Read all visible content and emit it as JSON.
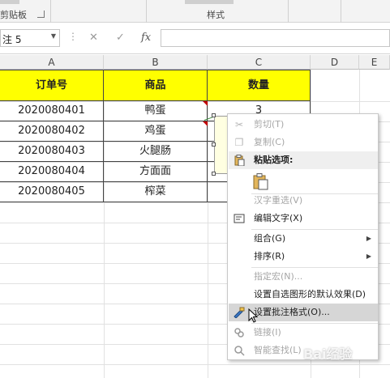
{
  "ribbon": {
    "clipboard_group": "剪贴板",
    "styles_group": "样式"
  },
  "formula_bar": {
    "name_box": "注 5",
    "cancel_icon": "✕",
    "enter_icon": "✓",
    "fx_label": "fx",
    "formula_value": ""
  },
  "columns": [
    "A",
    "B",
    "C",
    "D",
    "E"
  ],
  "table": {
    "headers": [
      "订单号",
      "商品",
      "数量"
    ],
    "rows": [
      {
        "order": "2020080401",
        "product": "鸭蛋",
        "qty": "3"
      },
      {
        "order": "2020080402",
        "product": "鸡蛋",
        "qty": ""
      },
      {
        "order": "2020080403",
        "product": "火腿肠",
        "qty": ""
      },
      {
        "order": "2020080404",
        "product": "方面面",
        "qty": ""
      },
      {
        "order": "2020080405",
        "product": "榨菜",
        "qty": ""
      }
    ]
  },
  "colors": {
    "header_fill": "#ffff00",
    "comment_fill": "#ffffe1",
    "comment_marker": "#c00000"
  },
  "context_menu": {
    "items": [
      {
        "label": "剪切(T)",
        "icon": "scissors-icon",
        "disabled": true
      },
      {
        "label": "复制(C)",
        "icon": "copy-icon",
        "disabled": true
      },
      {
        "label": "粘贴选项:",
        "icon": "paste-icon",
        "disabled": false
      },
      {
        "label": "汉字重选(V)",
        "icon": "",
        "disabled": true
      },
      {
        "label": "编辑文字(X)",
        "icon": "edit-text-icon",
        "disabled": false
      },
      {
        "label": "组合(G)",
        "icon": "",
        "disabled": false,
        "submenu": true
      },
      {
        "label": "排序(R)",
        "icon": "",
        "disabled": false,
        "submenu": true
      },
      {
        "label": "指定宏(N)...",
        "icon": "",
        "disabled": true
      },
      {
        "label": "设置自选图形的默认效果(D)",
        "icon": "",
        "disabled": false
      },
      {
        "label": "设置批注格式(O)...",
        "icon": "format-comment-icon",
        "disabled": false,
        "highlighted": true
      },
      {
        "label": "链接(I)",
        "icon": "link-icon",
        "disabled": true
      },
      {
        "label": "智能查找(L)",
        "icon": "search-icon",
        "disabled": true
      }
    ]
  },
  "watermark": "Bai经验"
}
